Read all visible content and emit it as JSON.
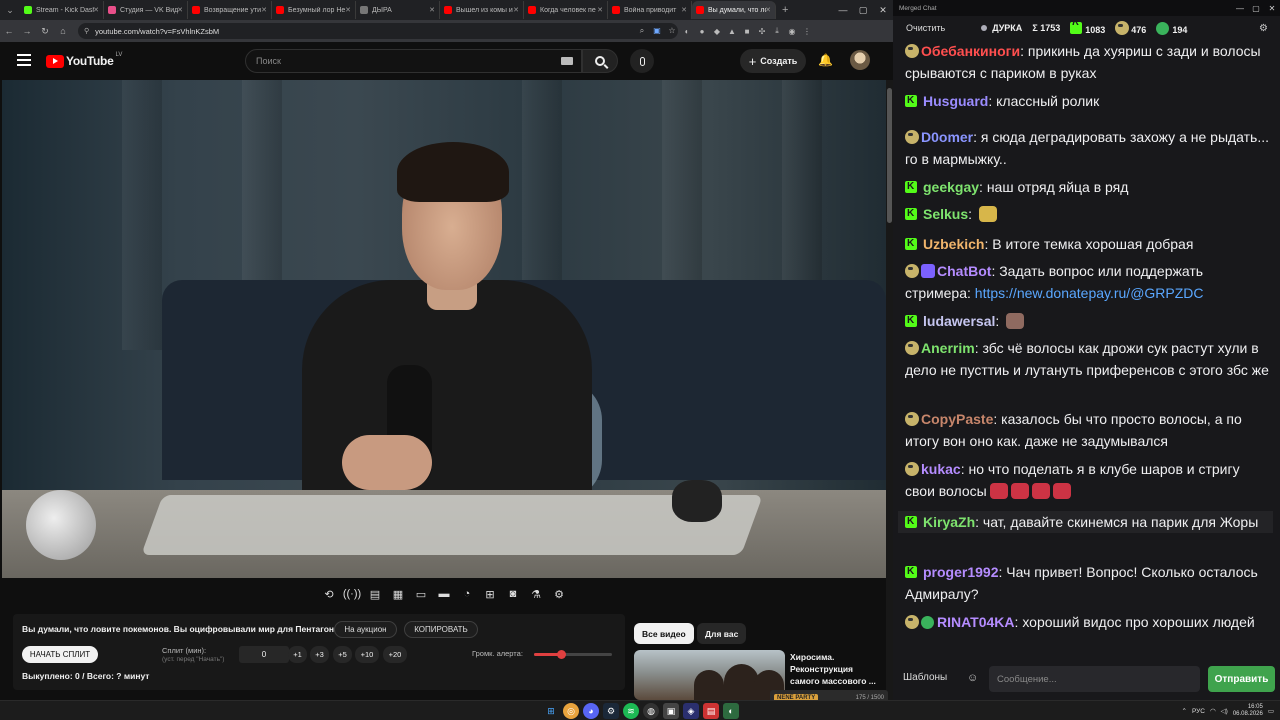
{
  "browser": {
    "tabs": [
      {
        "title": "Stream - Kick Dash",
        "color": "#53fc18"
      },
      {
        "title": "Студия — VK Видео",
        "color": "#e94f8a"
      },
      {
        "title": "Возвращение ути",
        "color": "#f00"
      },
      {
        "title": "Безумный лор Не",
        "color": "#f00"
      },
      {
        "title": "ДЫРА",
        "color": "#777"
      },
      {
        "title": "Вышел из комы и",
        "color": "#f00"
      },
      {
        "title": "Когда человек пе",
        "color": "#f00"
      },
      {
        "title": "Война приводит",
        "color": "#f00"
      },
      {
        "title": "Вы думали, что ло",
        "color": "#f00"
      }
    ],
    "url": "youtube.com/watch?v=FsVhlnKZsbM"
  },
  "youtube": {
    "logo": "YouTube",
    "country": "LV",
    "search_placeholder": "Поиск",
    "create_label": "Создать"
  },
  "panel": {
    "title": "Вы думали, что ловите покемонов. Вы оцифровывали мир для Пентагона",
    "auction_label": "На аукцион",
    "copy_label": "КОПИРОВАТЬ",
    "start_split_label": "НАЧАТЬ СПЛИТ",
    "split_label": "Сплит (мин):",
    "split_hint": "(уст. перед \"Начать\")",
    "split_value": "0",
    "increments": [
      "+1",
      "+3",
      "+5",
      "+10",
      "+20"
    ],
    "alert_volume_label": "Громк. алерта:",
    "alert_volume": 0.35,
    "bought_text": "Выкуплено: 0 / Всего: ? минут"
  },
  "recommendations": {
    "chips": [
      "Все видео",
      "Для вас"
    ],
    "first_title": "Хиросима. Реконструкция самого массового ..."
  },
  "nene": {
    "badge": "NENE PARTY",
    "count": "175 / 1500"
  },
  "chat": {
    "window_title": "Merged Chat",
    "clear_label": "Очистить",
    "streamer": "ДУРКА",
    "total": "Σ 1753",
    "kick_count": "1083",
    "twitch_count": "476",
    "other_count": "194",
    "messages": [
      {
        "badge": "w",
        "user": "Обебанкиноги",
        "color": "#ff4f4f",
        "text": "прикинь да хуяриш с зади и волосы срываются с париком в руках"
      },
      {
        "badge": "k",
        "user": "Husguard",
        "color": "#9b8cff",
        "text": "классный ролик"
      },
      {
        "badge": "w",
        "user": "D0omer",
        "color": "#8a95ff",
        "text": "я сюда деградировать захожу а не рыдать... го в мармыжку.."
      },
      {
        "badge": "k",
        "user": "geekgay",
        "color": "#7ee36e",
        "text": "наш отряд яйца в ряд"
      },
      {
        "badge": "k",
        "user": "Selkus",
        "color": "#7ee36e",
        "text": ""
      },
      {
        "badge": "k",
        "user": "Uzbekich",
        "color": "#f0b46b",
        "text": "В итоге темка хорошая добрая"
      },
      {
        "badge": "wb",
        "user": "ChatBot",
        "color": "#b58cff",
        "text": "Задать вопрос или поддержать стримера:",
        "link": "https://new.donatepay.ru/@GRPZDC"
      },
      {
        "badge": "k",
        "user": "ludawersal",
        "color": "#c6c6f0",
        "text": ""
      },
      {
        "badge": "w",
        "user": "Anerrim",
        "color": "#7ee36e",
        "text": "збс чё волосы как дрожи сук растут хули в дело не пусттиь и лутануть приференсов с этого збс же"
      },
      {
        "badge": "w",
        "user": "CopyPaste",
        "color": "#c7866b",
        "text": "казалось бы что просто волосы, а по итогу вон оно как. даже не задумывался"
      },
      {
        "badge": "w",
        "user": "kukac",
        "color": "#b58cff",
        "text": "но что поделать я в клубе шаров и стригу свои волосы"
      },
      {
        "badge": "k",
        "user": "KiryaZh",
        "color": "#7ee36e",
        "text": "чат, давайте скинемся на парик для Жоры"
      },
      {
        "badge": "k",
        "user": "proger1992",
        "color": "#b58cff",
        "text": "Чач привет! Вопрос! Сколько осталось Адмиралу?"
      },
      {
        "badge": "wg",
        "user": "RINAT04KA",
        "color": "#b58cff",
        "text": "хороший видос про хороших людей"
      }
    ],
    "templates_label": "Шаблоны",
    "input_placeholder": "Сообщение...",
    "send_label": "Отправить"
  },
  "taskbar": {
    "lang": "РУС",
    "time": "16:05",
    "date": "06.08.2026"
  }
}
